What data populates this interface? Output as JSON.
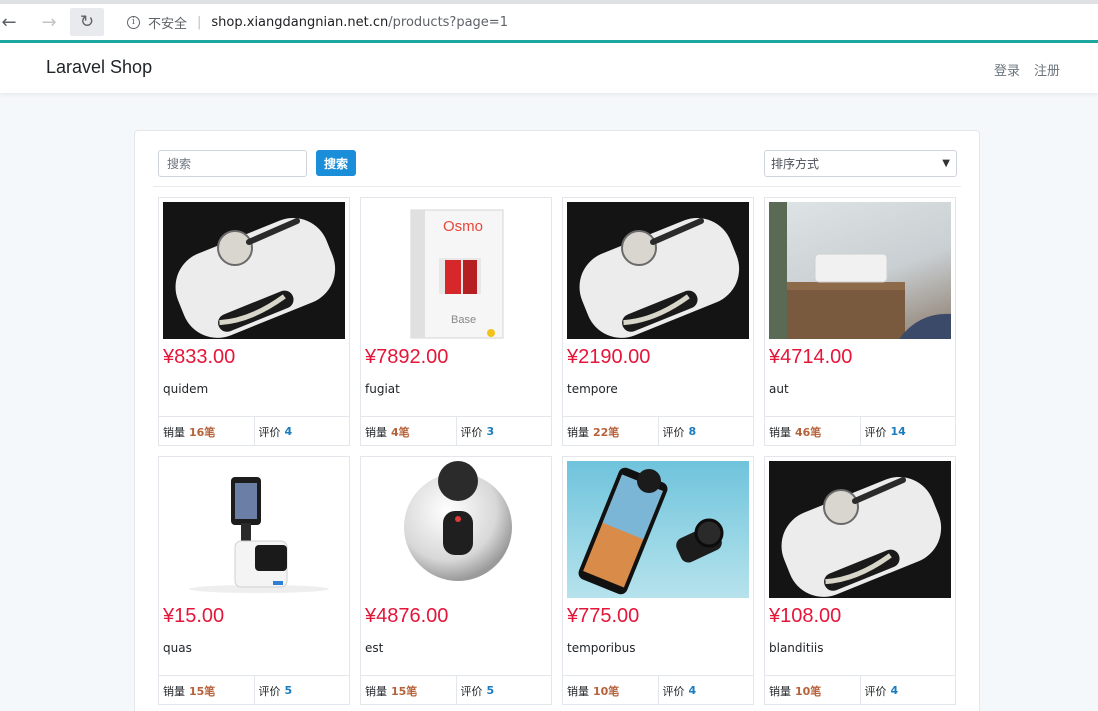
{
  "browser": {
    "insecure_label": "不安全",
    "url_host": "shop.xiangdangnian.net.cn",
    "url_path": "/products?page=1"
  },
  "navbar": {
    "brand": "Laravel Shop",
    "login": "登录",
    "register": "注册"
  },
  "filter": {
    "search_placeholder": "搜索",
    "search_button": "搜索",
    "sort_label": "排序方式"
  },
  "labels": {
    "sold": "销量",
    "reviews": "评价"
  },
  "products": [
    {
      "price": "¥833.00",
      "name": "quidem",
      "sold": "16笔",
      "reviews": "4",
      "image": "white-gadget"
    },
    {
      "price": "¥7892.00",
      "name": "fugiat",
      "sold": "4笔",
      "reviews": "3",
      "image": "osmo-box",
      "box_brand": "Osmo",
      "box_text": "Base"
    },
    {
      "price": "¥2190.00",
      "name": "tempore",
      "sold": "22笔",
      "reviews": "8",
      "image": "white-gadget"
    },
    {
      "price": "¥4714.00",
      "name": "aut",
      "sold": "46笔",
      "reviews": "14",
      "image": "speaker"
    },
    {
      "price": "¥15.00",
      "name": "quas",
      "sold": "15笔",
      "reviews": "5",
      "image": "tablet-robot"
    },
    {
      "price": "¥4876.00",
      "name": "est",
      "sold": "15笔",
      "reviews": "5",
      "image": "360-camera"
    },
    {
      "price": "¥775.00",
      "name": "temporibus",
      "sold": "10笔",
      "reviews": "4",
      "image": "phone-lens"
    },
    {
      "price": "¥108.00",
      "name": "blanditiis",
      "sold": "10笔",
      "reviews": "4",
      "image": "white-gadget"
    }
  ]
}
